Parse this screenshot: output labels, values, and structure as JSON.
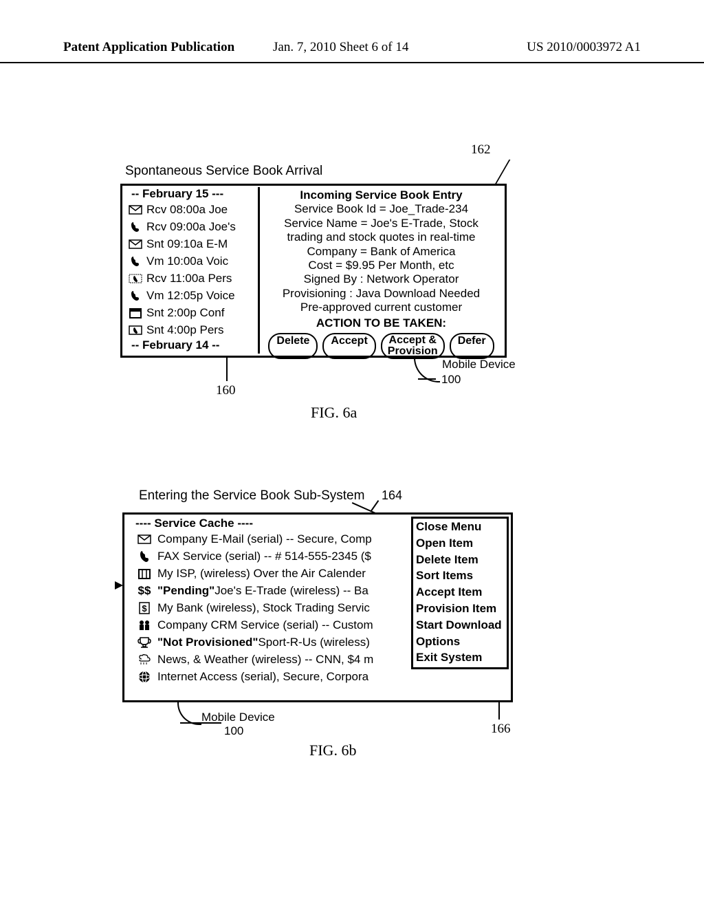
{
  "header": {
    "left": "Patent Application Publication",
    "mid": "Jan. 7, 2010   Sheet 6 of 14",
    "right": "US 2010/0003972 A1"
  },
  "fig6a": {
    "ref162": "162",
    "ref160": "160",
    "ref100": "100",
    "mdlabel": "Mobile Device",
    "title": "Spontaneous Service  Book Arrival",
    "caption": "FIG. 6a",
    "date1": "-- February 15 ---",
    "date2": "-- February 14 --",
    "rows": [
      {
        "icon_name": "mail-icon",
        "text": "Rcv 08:00a Joe"
      },
      {
        "icon_name": "phone-icon",
        "text": "Rcv 09:00a Joe's"
      },
      {
        "icon_name": "mail-icon",
        "text": "Snt  09:10a E-M"
      },
      {
        "icon_name": "phone-icon",
        "text": "Vm  10:00a Voic"
      },
      {
        "icon_name": "calendar-phone-icon",
        "text": "Rcv 11:00a Pers"
      },
      {
        "icon_name": "phone-icon",
        "text": "Vm 12:05p Voice"
      },
      {
        "icon_name": "calendar-icon",
        "text": "Snt   2:00p Conf"
      },
      {
        "icon_name": "calendar-phone-icon",
        "text": "Snt   4:00p Pers"
      }
    ],
    "right_title": "Incoming Service Book Entry",
    "lines": [
      "Service Book Id = Joe_Trade-234",
      "Service Name = Joe's E-Trade, Stock",
      "trading and stock quotes in real-time",
      "Company = Bank of America",
      "Cost = $9.95 Per Month, etc",
      "Signed By : Network Operator",
      "Provisioning : Java Download Needed",
      "Pre-approved current customer"
    ],
    "action_header": "ACTION  TO BE TAKEN:",
    "btn_delete": "Delete",
    "btn_accept": "Accept",
    "btn_ap_1": "Accept &",
    "btn_ap_2": "Provision",
    "btn_defer": "Defer"
  },
  "fig6b": {
    "title": "Entering the Service Book Sub-System",
    "caption": "FIG. 6b",
    "ref164": "164",
    "ref166": "166",
    "ref100": "100",
    "mdlabel": "Mobile Device",
    "service_hdr": "---- Service  Cache ----",
    "rows": [
      {
        "icon_name": "mail-icon",
        "prefix": "",
        "bold": "",
        "text": "Company E-Mail (serial) -- Secure, Comp"
      },
      {
        "icon_name": "phone-icon",
        "prefix": "",
        "bold": "",
        "text": "FAX Service (serial) -- # 514-555-2345 ($"
      },
      {
        "icon_name": "calendar-icon",
        "prefix": "",
        "bold": "",
        "text": "My ISP, (wireless) Over the Air Calender"
      },
      {
        "icon_name": "dollar-icon",
        "prefix": "",
        "bold": "\"Pending\"",
        "text": " Joe's E-Trade (wireless) -- Ba"
      },
      {
        "icon_name": "dollar-box-icon",
        "prefix": "",
        "bold": "",
        "text": "My Bank (wireless), Stock Trading Servic"
      },
      {
        "icon_name": "people-icon",
        "prefix": "",
        "bold": "",
        "text": "Company CRM Service (serial) -- Custom"
      },
      {
        "icon_name": "trophy-icon",
        "prefix": "",
        "bold": "\"Not Provisioned\"",
        "text": " Sport-R-Us (wireless)"
      },
      {
        "icon_name": "weather-icon",
        "prefix": "",
        "bold": "",
        "text": "News, & Weather (wireless) -- CNN, $4 m"
      },
      {
        "icon_name": "globe-icon",
        "prefix": "",
        "bold": "",
        "text": "Internet Access (serial), Secure, Corpora"
      }
    ],
    "menu": [
      "Close Menu",
      "Open Item",
      "Delete Item",
      "Sort Items",
      "Accept Item",
      "Provision Item",
      "Start Download",
      "Options",
      "Exit System"
    ]
  }
}
